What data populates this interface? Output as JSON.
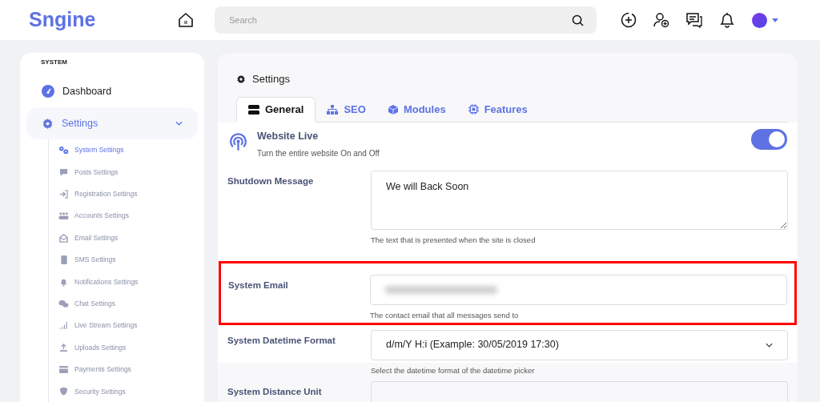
{
  "header": {
    "logo": "Sngine",
    "search": {
      "placeholder": "Search"
    }
  },
  "sidebar": {
    "section": "SYSTEM",
    "items": [
      {
        "label": "Dashboard",
        "kind": "top",
        "selected": false
      },
      {
        "label": "Settings",
        "kind": "group",
        "selected": true,
        "expanded": true,
        "children": [
          {
            "label": "System Settings",
            "selected": true
          },
          {
            "label": "Posts Settings",
            "selected": false
          },
          {
            "label": "Registration Settings",
            "selected": false
          },
          {
            "label": "Accounts Settings",
            "selected": false
          },
          {
            "label": "Email Settings",
            "selected": false
          },
          {
            "label": "SMS Settings",
            "selected": false
          },
          {
            "label": "Notifications Settings",
            "selected": false
          },
          {
            "label": "Chat Settings",
            "selected": false
          },
          {
            "label": "Live Stream Settings",
            "selected": false
          },
          {
            "label": "Uploads Settings",
            "selected": false
          },
          {
            "label": "Payments Settings",
            "selected": false
          },
          {
            "label": "Security Settings",
            "selected": false
          }
        ]
      }
    ]
  },
  "main": {
    "title": "Settings",
    "tabs": [
      {
        "label": "General",
        "selected": true
      },
      {
        "label": "SEO",
        "selected": false
      },
      {
        "label": "Modules",
        "selected": false
      },
      {
        "label": "Features",
        "selected": false
      }
    ],
    "toggle": {
      "title": "Website Live",
      "description": "Turn the entire website On and Off",
      "on": true
    },
    "fields": [
      {
        "label": "Shutdown Message",
        "kind": "textarea",
        "value": "We will Back Soon",
        "help": "The text that is presented when the site is closed",
        "highlighted": false
      },
      {
        "label": "System Email",
        "kind": "blurred",
        "help": "The contact email that all messages send to",
        "highlighted": true
      },
      {
        "label": "System Datetime Format",
        "kind": "select",
        "value": "d/m/Y H:i (Example: 30/05/2019 17:30)",
        "help": "Select the datetime format of the datetime picker",
        "highlighted": false
      },
      {
        "label": "System Distance Unit",
        "kind": "text",
        "highlighted": false
      }
    ]
  }
}
